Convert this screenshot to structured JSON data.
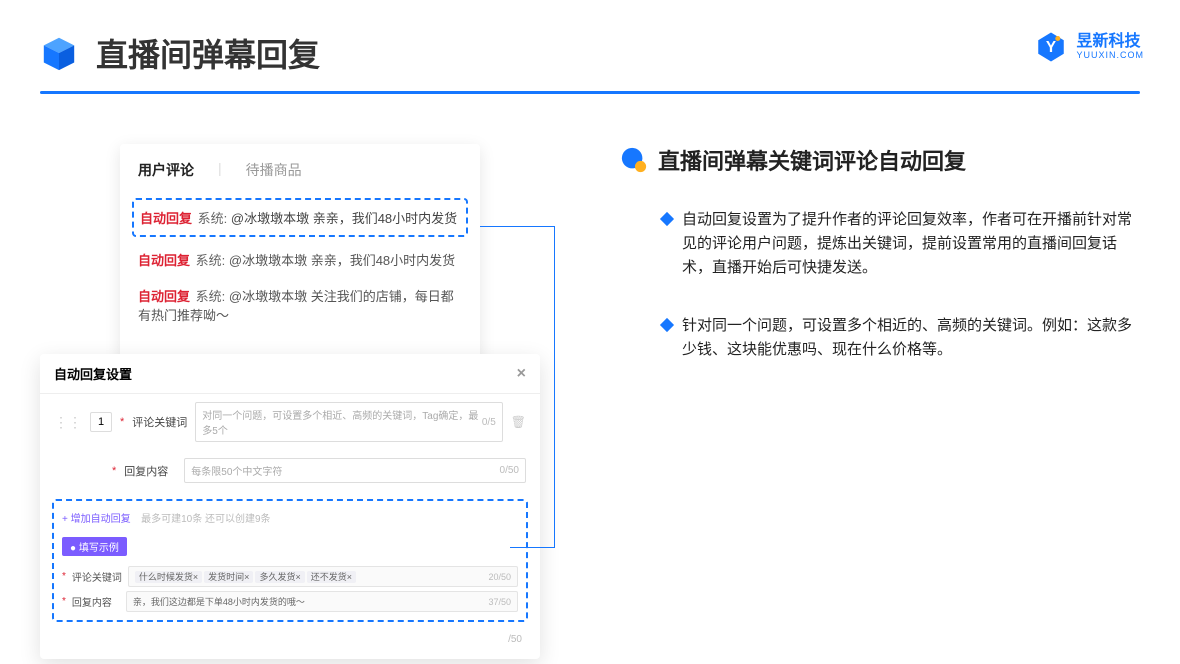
{
  "header": {
    "title": "直播间弹幕回复"
  },
  "logo": {
    "cn": "昱新科技",
    "en": "YUUXIN.COM"
  },
  "section": {
    "title": "直播间弹幕关键词评论自动回复"
  },
  "bullets": [
    "自动回复设置为了提升作者的评论回复效率，作者可在开播前针对常见的评论用户问题，提炼出关键词，提前设置常用的直播间回复话术，直播开始后可快捷发送。",
    "针对同一个问题，可设置多个相近的、高频的关键词。例如：这款多少钱、这块能优惠吗、现在什么价格等。"
  ],
  "panelTop": {
    "tab1": "用户评论",
    "tab2": "待播商品",
    "row1_tag": "自动回复",
    "row1_sys": "系统:",
    "row1_text": "@冰墩墩本墩 亲亲，我们48小时内发货",
    "row2_text": "@冰墩墩本墩 亲亲，我们48小时内发货",
    "row3_text": "@冰墩墩本墩 关注我们的店铺，每日都有热门推荐呦～"
  },
  "panelBottom": {
    "title": "自动回复设置",
    "idx": "1",
    "label_keyword": "评论关键词",
    "placeholder_keyword": "对同一个问题，可设置多个相近、高频的关键词，Tag确定，最多5个",
    "count_keyword": "0/5",
    "label_content": "回复内容",
    "placeholder_content": "每条限50个中文字符",
    "count_content": "0/50",
    "add_link": "+ 增加自动回复",
    "add_hint": "最多可建10条 还可以创建9条",
    "ex_badge": "● 填写示例",
    "ex_label_kw": "评论关键词",
    "ex_tags": [
      "什么时候发货×",
      "发货时间×",
      "多久发货×",
      "还不发货×"
    ],
    "ex_count_kw": "20/50",
    "ex_label_ct": "回复内容",
    "ex_content": "亲，我们这边都是下单48小时内发货的哦～",
    "ex_count_ct": "37/50",
    "extra_count": "/50"
  }
}
